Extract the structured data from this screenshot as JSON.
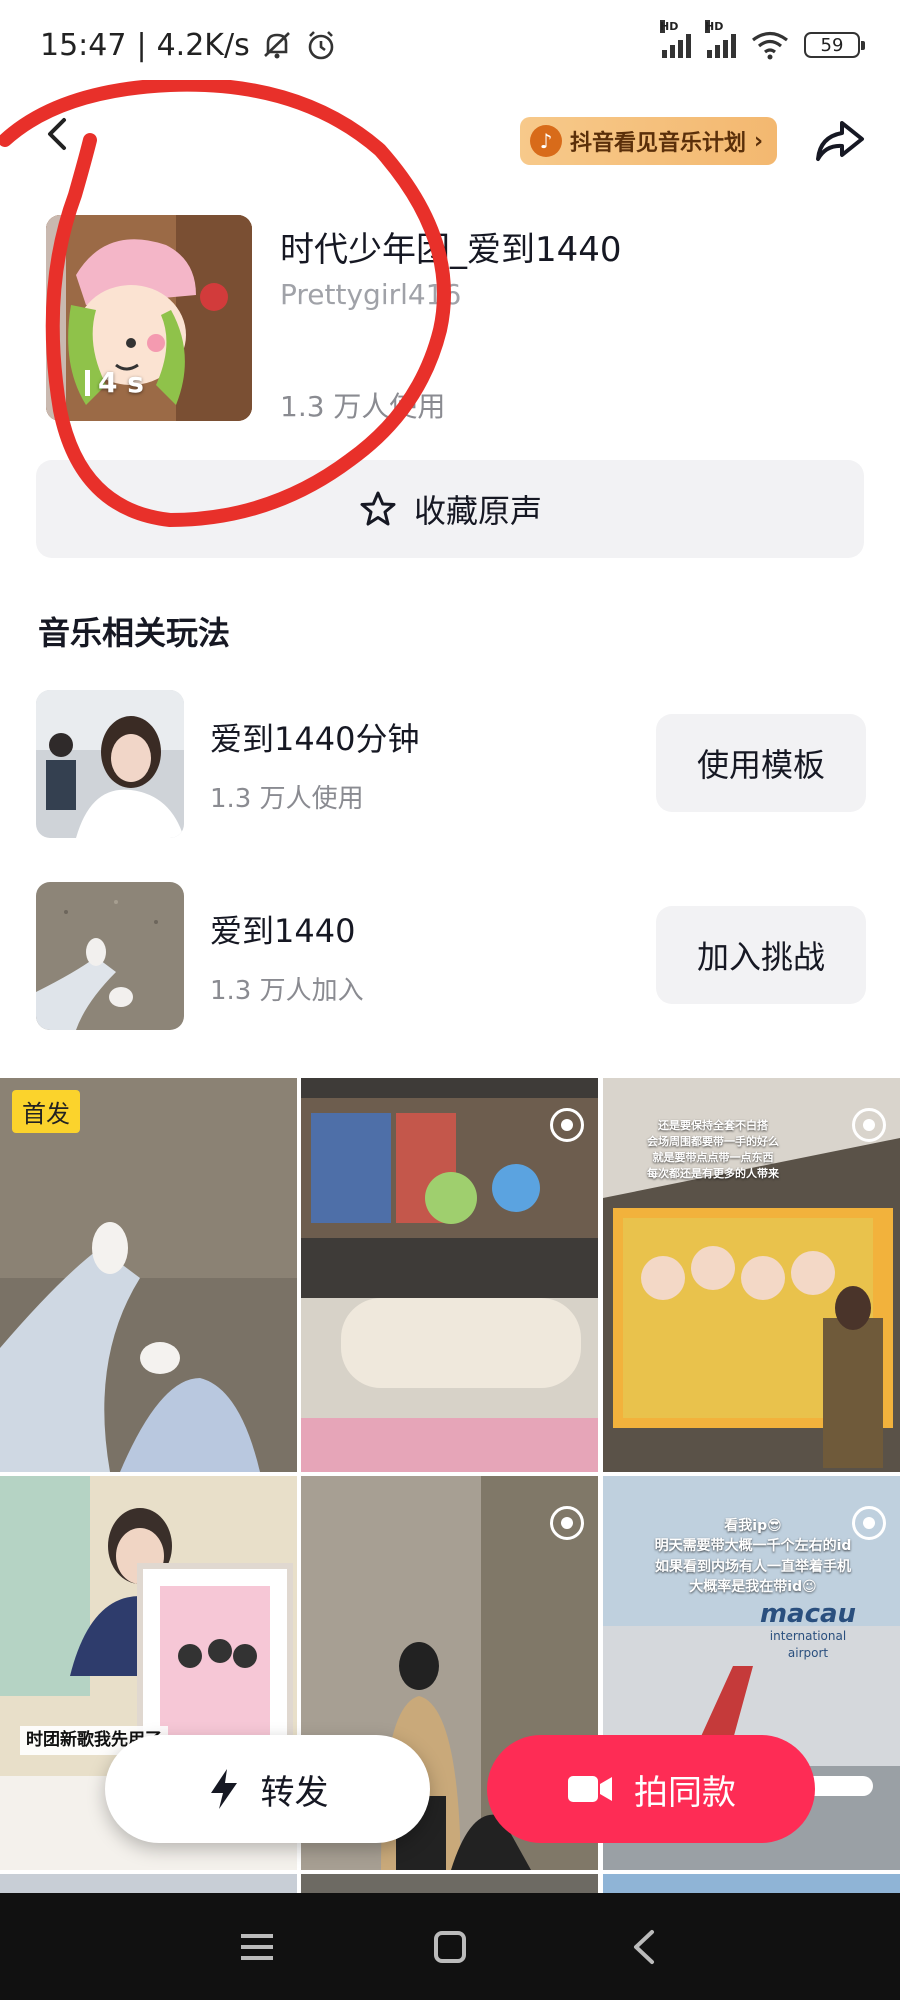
{
  "status_bar": {
    "time": "15:47",
    "network_speed": "4.2K/s",
    "signal_label_1": "HD",
    "signal_label_2": "HD",
    "battery": "59"
  },
  "topbar": {
    "promo_label": "抖音看见音乐计划",
    "promo_arrow": "›"
  },
  "music": {
    "title": "时代少年团_爱到1440",
    "author": "Prettygirl416",
    "duration": "4 s",
    "usage": "1.3 万人使用",
    "favorite_label": "收藏原声"
  },
  "related": {
    "section_title": "音乐相关玩法",
    "items": [
      {
        "title": "爱到1440分钟",
        "subtitle": "1.3 万人使用",
        "button": "使用模板"
      },
      {
        "title": "爱到1440",
        "subtitle": "1.3 万人加入",
        "button": "加入挑战"
      }
    ]
  },
  "grid": {
    "first_tag": "首发",
    "cell4_caption": "时团新歌我先用了",
    "cell6_caption_lines": [
      "看我ip😎",
      "明天需要带大概一千个左右的id",
      "如果看到内场有人一直举着手机",
      "大概率是我在带id😉"
    ],
    "cell6_sign": "macau",
    "cell6_sign_sub": "international airport",
    "cell3_caption_lines": [
      "还是要保持全套不白搭",
      "会场周围都要带一手的好么",
      "就是要带点点带一点东西",
      "每次都还是有更多的人带来"
    ]
  },
  "actions": {
    "forward_label": "转发",
    "shoot_label": "拍同款"
  },
  "colors": {
    "accent": "#fe2c55",
    "annotation": "#e8302a",
    "tag_yellow": "#fbd32c"
  }
}
